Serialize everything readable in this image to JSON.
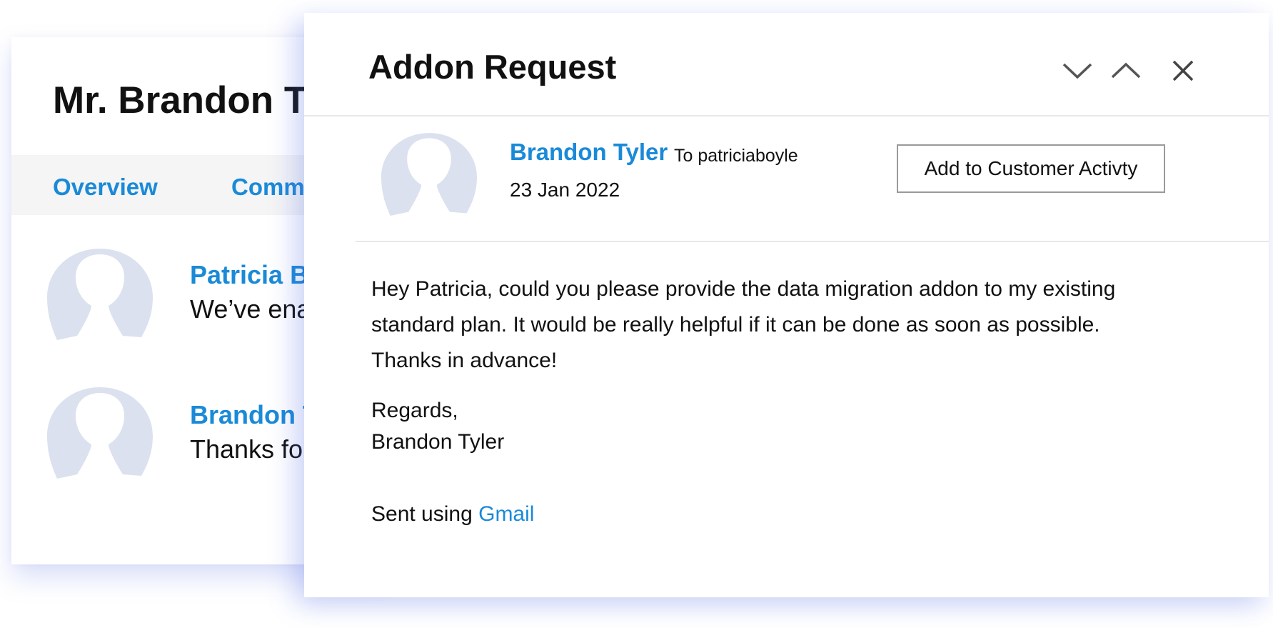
{
  "background_card": {
    "title": "Mr. Brandon Ty",
    "tabs": [
      {
        "label": "Overview"
      },
      {
        "label": "Comm"
      }
    ],
    "conversation": [
      {
        "name": "Patricia B",
        "snippet": "We’ve ena"
      },
      {
        "name": "Brandon T",
        "snippet": "Thanks fo"
      }
    ]
  },
  "email": {
    "subject": "Addon Request",
    "controls": {
      "next_icon": "chevron-down-icon",
      "previous_icon": "chevron-up-icon",
      "close_icon": "close-icon"
    },
    "sender": "Brandon Tyler",
    "to": "To patriciaboyle",
    "date": "23 Jan 2022",
    "action_button": "Add to Customer Activty",
    "body_lines": [
      "Hey Patricia, could you please provide the data migration addon to my existing",
      "standard plan. It would be really helpful if it can be done as soon as possible.",
      "Thanks in advance!"
    ],
    "signoff": "Regards,",
    "signature": "Brandon Tyler",
    "sent_using_prefix": "Sent using ",
    "sent_using_link": "Gmail"
  },
  "colors": {
    "accent": "#1a8ad8",
    "avatar": "#dbe1ee",
    "shadow": "#566ee6"
  }
}
